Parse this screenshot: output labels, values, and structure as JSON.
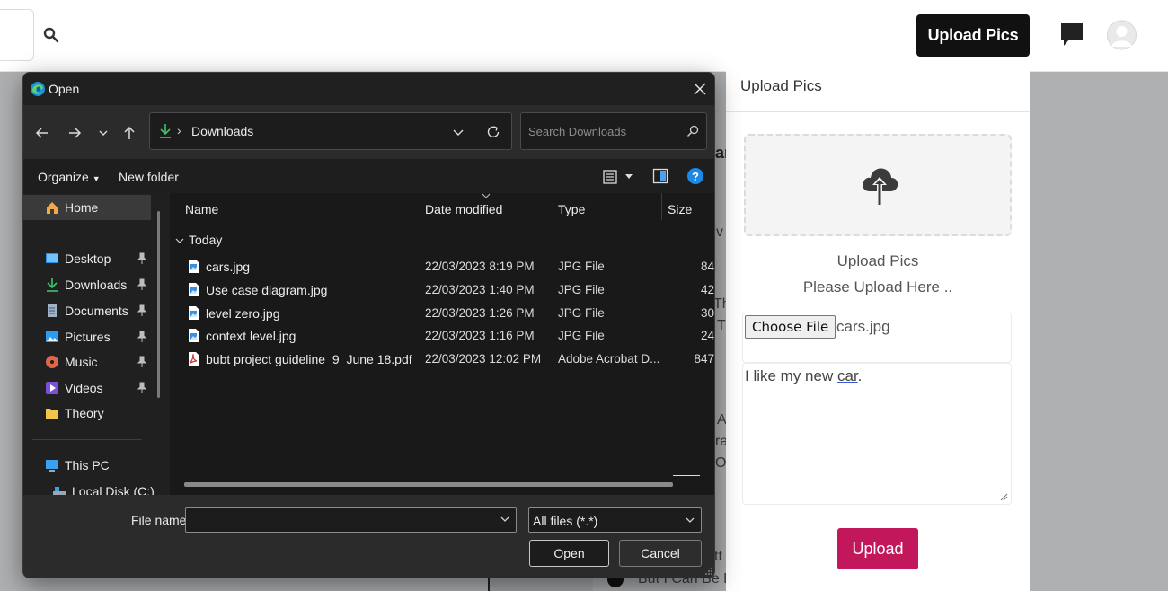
{
  "page": {
    "upload_button_label": "Upload Pics",
    "background_fragments": [
      "ar",
      "v",
      "Th",
      "T",
      "A",
      "ra",
      "O",
      "tt",
      "But I Can Be F"
    ]
  },
  "panel": {
    "title": "Upload Pics",
    "heading": "Upload Pics",
    "subheading": "Please Upload Here ..",
    "choose_file_label": "Choose File",
    "chosen_file": "cars.jpg",
    "caption_before": "I like my new ",
    "caption_word": "car",
    "caption_after": ".",
    "submit_label": "Upload",
    "accent_color": "#c2185b"
  },
  "dialog": {
    "title": "Open",
    "address_folder": "Downloads",
    "search_placeholder": "Search Downloads",
    "organize_label": "Organize",
    "new_folder_label": "New folder",
    "nav": {
      "home": "Home",
      "desktop": "Desktop",
      "downloads": "Downloads",
      "documents": "Documents",
      "pictures": "Pictures",
      "music": "Music",
      "videos": "Videos",
      "theory": "Theory",
      "this_pc": "This PC",
      "local_disk": "Local Disk (C:)"
    },
    "columns": {
      "name": "Name",
      "date": "Date modified",
      "type": "Type",
      "size": "Size"
    },
    "group_label": "Today",
    "files": [
      {
        "name": "cars.jpg",
        "date": "22/03/2023 8:19 PM",
        "type": "JPG File",
        "size": "84",
        "kind": "image"
      },
      {
        "name": "Use case diagram.jpg",
        "date": "22/03/2023 1:40 PM",
        "type": "JPG File",
        "size": "42",
        "kind": "image"
      },
      {
        "name": "level zero.jpg",
        "date": "22/03/2023 1:26 PM",
        "type": "JPG File",
        "size": "30",
        "kind": "image"
      },
      {
        "name": "context level.jpg",
        "date": "22/03/2023 1:16 PM",
        "type": "JPG File",
        "size": "24",
        "kind": "image"
      },
      {
        "name": "bubt project guideline_9_June 18.pdf",
        "date": "22/03/2023 12:02 PM",
        "type": "Adobe Acrobat D...",
        "size": "847",
        "kind": "pdf"
      }
    ],
    "file_name_label": "File name:",
    "file_name_value": "",
    "filter_label": "All files (*.*)",
    "open_label": "Open",
    "cancel_label": "Cancel"
  }
}
